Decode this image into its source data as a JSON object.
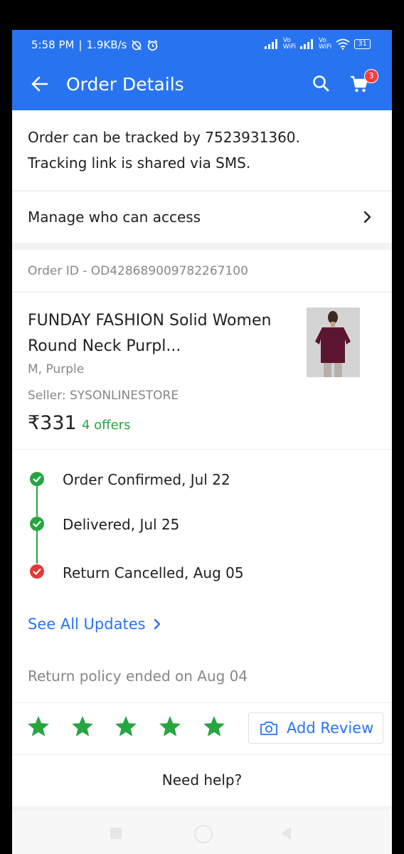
{
  "status_bar": {
    "time": "5:58 PM",
    "speed": "1.9KB/s",
    "vowifi_1": [
      "Vo",
      "WiFi"
    ],
    "vowifi_2": [
      "Vo",
      "WiFi"
    ],
    "battery": "31"
  },
  "header": {
    "title": "Order Details",
    "cart_count": "3",
    "icons": [
      "back-arrow-icon",
      "search-icon",
      "cart-icon"
    ],
    "color": "#2874f0"
  },
  "tracking": {
    "line1": "Order can be tracked by 7523931360.",
    "line2": "Tracking link is shared via SMS."
  },
  "manage_access": {
    "label": "Manage who can access"
  },
  "order": {
    "id_text": "Order ID - OD428689009782267100"
  },
  "product": {
    "name": "FUNDAY FASHION Solid Women Round Neck Purpl...",
    "variant": "M, Purple",
    "seller": "Seller: SYSONLINESTORE",
    "price": "₹331",
    "offers": "4 offers"
  },
  "timeline": [
    {
      "label": "Order Confirmed, Jul 22",
      "status": "done",
      "color": "#26a541"
    },
    {
      "label": "Delivered, Jul 25",
      "status": "done",
      "color": "#26a541"
    },
    {
      "label": "Return Cancelled, Aug 05",
      "status": "cancelled",
      "color": "#e53935"
    }
  ],
  "see_all": {
    "label": "See All Updates"
  },
  "policy": {
    "text": "Return policy ended on Aug 04"
  },
  "rating": {
    "stars": 5,
    "add_review_label": "Add Review",
    "star_color": "#26a541"
  },
  "help": {
    "label": "Need help?"
  }
}
